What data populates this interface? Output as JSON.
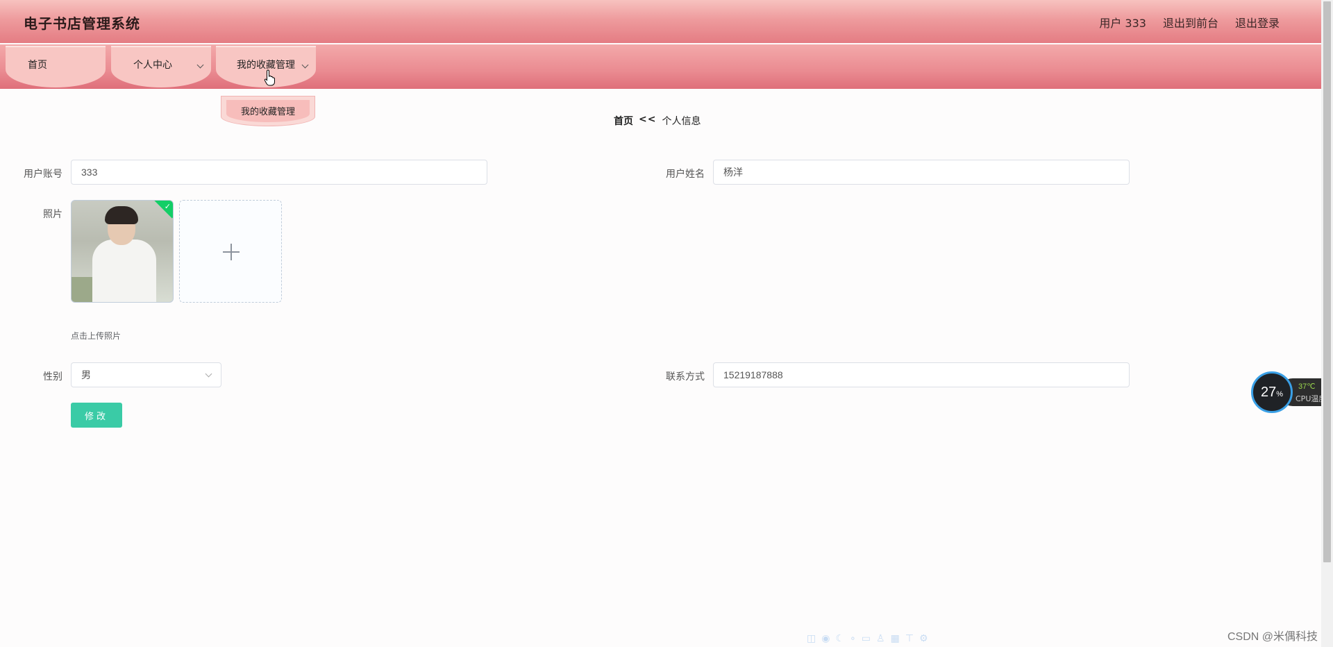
{
  "header": {
    "app_title": "电子书店管理系统",
    "user_label": "用户 333",
    "back_to_front": "退出到前台",
    "logout": "退出登录"
  },
  "nav": {
    "items": [
      {
        "label": "首页",
        "has_dropdown": false
      },
      {
        "label": "个人中心",
        "has_dropdown": true
      },
      {
        "label": "我的收藏管理",
        "has_dropdown": true
      }
    ],
    "open_dropdown": {
      "items": [
        "我的收藏管理"
      ]
    }
  },
  "breadcrumb": {
    "home": "首页",
    "separator": "<<",
    "current": "个人信息"
  },
  "form": {
    "account_label": "用户账号",
    "account_value": "333",
    "name_label": "用户姓名",
    "name_value": "杨洋",
    "photo_label": "照片",
    "upload_tip": "点击上传照片",
    "gender_label": "性别",
    "gender_value": "男",
    "contact_label": "联系方式",
    "contact_value": "15219187888",
    "submit_label": "修改"
  },
  "cpu_widget": {
    "percent": "27",
    "percent_unit": "%",
    "temp": "37℃",
    "label": "CPU温度"
  },
  "watermark": "CSDN @米偶科技",
  "colors": {
    "header_top": "#f7c2bf",
    "header_bottom": "#e47c83",
    "nav_item": "#f8c6c3",
    "button": "#3acba6",
    "upload_success": "#13ce66"
  }
}
